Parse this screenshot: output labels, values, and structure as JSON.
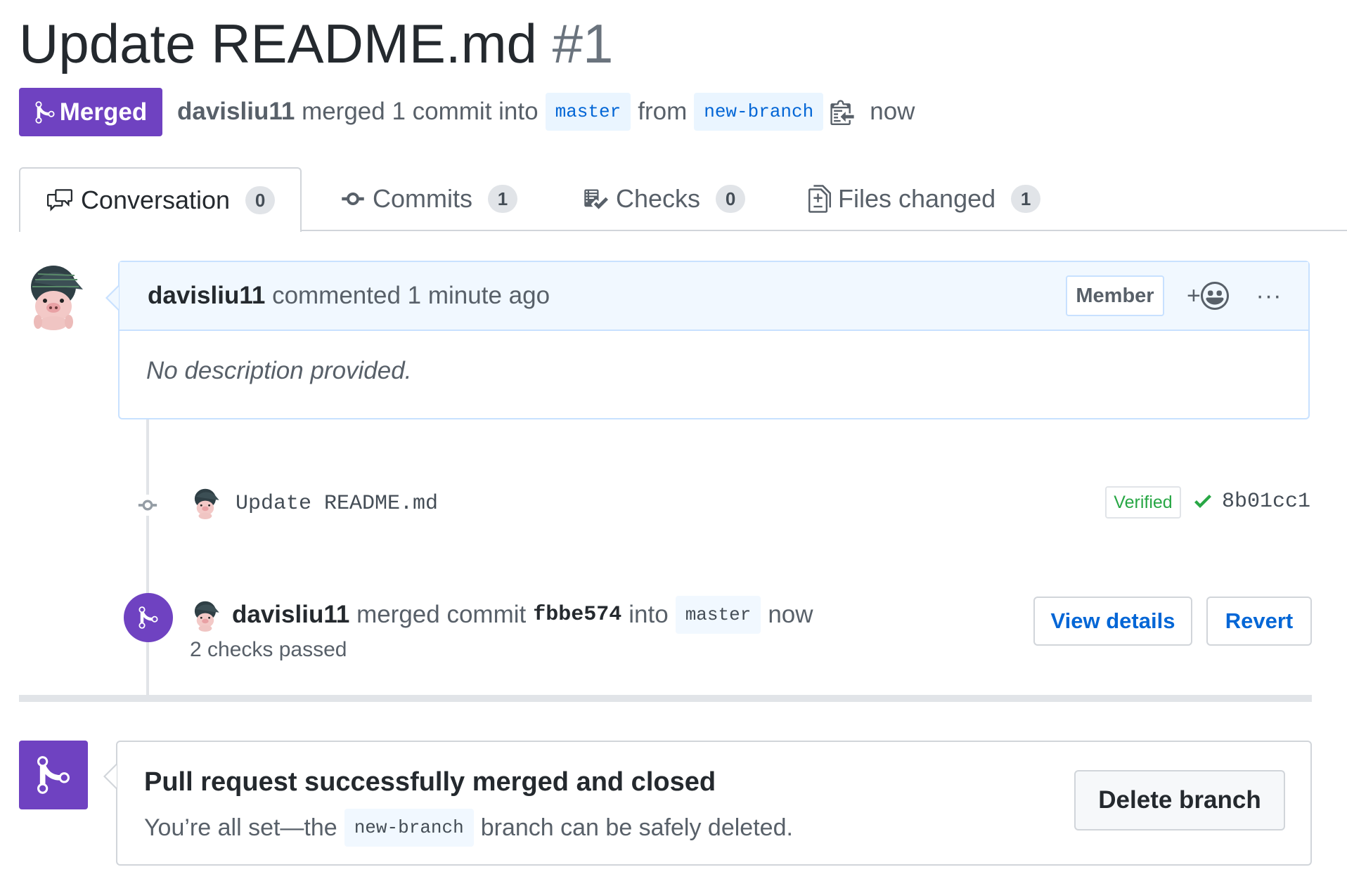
{
  "pr": {
    "title": "Update README.md",
    "number": "#1",
    "state": "Merged",
    "author": "davisliu11",
    "merge_text": "merged 1 commit into",
    "base_branch": "master",
    "from_text": "from",
    "head_branch": "new-branch",
    "time": "now"
  },
  "tabs": [
    {
      "label": "Conversation",
      "count": "0",
      "icon": "comment-discussion-icon"
    },
    {
      "label": "Commits",
      "count": "1",
      "icon": "git-commit-icon"
    },
    {
      "label": "Checks",
      "count": "0",
      "icon": "checklist-icon"
    },
    {
      "label": "Files changed",
      "count": "1",
      "icon": "file-diff-icon"
    }
  ],
  "comment": {
    "author": "davisliu11",
    "action": "commented",
    "time": "1 minute ago",
    "role_badge": "Member",
    "reaction_label": "+",
    "more_label": "···",
    "body": "No description provided."
  },
  "commit": {
    "message": "Update README.md",
    "verified": "Verified",
    "sha": "8b01cc1"
  },
  "merge_event": {
    "author": "davisliu11",
    "text": "merged commit",
    "sha": "fbbe574",
    "into": "into",
    "branch": "master",
    "time": "now",
    "checks": "2 checks passed",
    "view_details": "View details",
    "revert": "Revert"
  },
  "merged_box": {
    "heading": "Pull request successfully merged and closed",
    "sub_before": "You’re all set—the",
    "branch": "new-branch",
    "sub_after": "branch can be safely deleted.",
    "delete_button": "Delete branch"
  },
  "colors": {
    "merged_purple": "#6f42c1",
    "link_blue": "#0366d6",
    "verified_green": "#28a745"
  }
}
